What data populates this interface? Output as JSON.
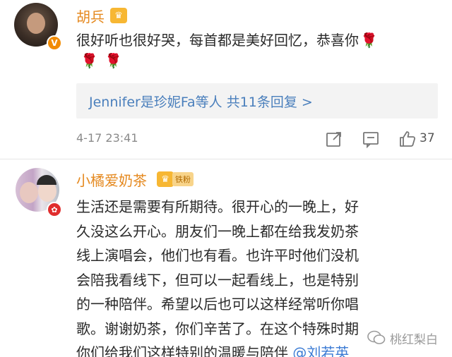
{
  "comment1": {
    "username": "胡兵",
    "text": "很好听也很好哭，每首都是美好回忆，恭喜你",
    "replies_summary": "Jennifer是珍妮Fa等人 共11条回复 >",
    "timestamp": "4-17 23:41",
    "like_count": "37",
    "badge": "V"
  },
  "comment2": {
    "username": "小橘爱奶茶",
    "fan_tag": "铁粉",
    "text": "生活还是需要有所期待。很开心的一晚上，好久没这么开心。朋友们一晚上都在给我发奶茶线上演唱会，他们也有看。也许平时他们没机会陪我看线下，但可以一起看线上，也是特别的一种陪伴。希望以后也可以这样经常听你唱歌。谢谢奶茶，你们辛苦了。在这个特殊时期你们给我们这样特别的温暖与陪伴",
    "mention": "@刘若英"
  },
  "icons": [
    "crown-icon",
    "rose-icon",
    "share-icon",
    "reply-icon",
    "like-icon",
    "verified-badge-icon",
    "wechat-icon"
  ],
  "watermark": {
    "text": "桃红梨白"
  },
  "colors": {
    "username": "#e5891f",
    "link": "#4a7fbc",
    "mention": "#3b7bd4",
    "rose": "#d21f2a"
  }
}
